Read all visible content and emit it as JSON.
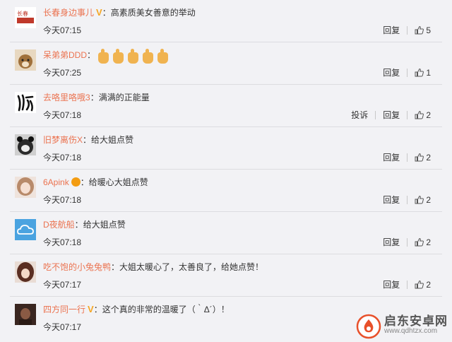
{
  "comments": [
    {
      "username": "长春身边事儿",
      "verified": "V",
      "text": "高素质美女善意的举动",
      "time": "今天07:15",
      "reply_label": "回复",
      "likes": "5",
      "avatar_color": "#c0392b"
    },
    {
      "username": "呆弟弟DDD",
      "text": "",
      "thumbs_emoji_count": 5,
      "time": "今天07:25",
      "reply_label": "回复",
      "likes": "1",
      "avatar_color": "#a0713c"
    },
    {
      "username": "去咯里咯哦3",
      "text": "满满的正能量",
      "time": "今天07:18",
      "report_label": "投诉",
      "reply_label": "回复",
      "likes": "2",
      "avatar_color": "#222222"
    },
    {
      "username": "旧梦离伤X",
      "text": "给大姐点赞",
      "time": "今天07:18",
      "reply_label": "回复",
      "likes": "2",
      "avatar_color": "#3a3a3a"
    },
    {
      "username": "6Apink",
      "text": "给暖心大姐点赞",
      "time": "今天07:18",
      "reply_label": "回复",
      "likes": "2",
      "avatar_color": "#d8b8a8"
    },
    {
      "username": "D夜航船",
      "text": "给大姐点赞",
      "time": "今天07:18",
      "reply_label": "回复",
      "likes": "2",
      "avatar_color": "#5dade2"
    },
    {
      "username": "吃不饱的小兔兔鸭",
      "text": "大姐太暖心了，太善良了，给她点赞！",
      "time": "今天07:17",
      "reply_label": "回复",
      "likes": "2",
      "avatar_color": "#7b4a3a"
    },
    {
      "username": "四方同一行",
      "verified": "V",
      "text": "这个真的非常的温暖了（｀Δ´）！",
      "time": "今天07:17",
      "avatar_color": "#4a3028"
    }
  ],
  "avatar_badges": {
    "first": "长春"
  },
  "watermark": {
    "title": "启东安卓网",
    "url": "www.qdhtzx.com",
    "color": "#e8502a"
  }
}
